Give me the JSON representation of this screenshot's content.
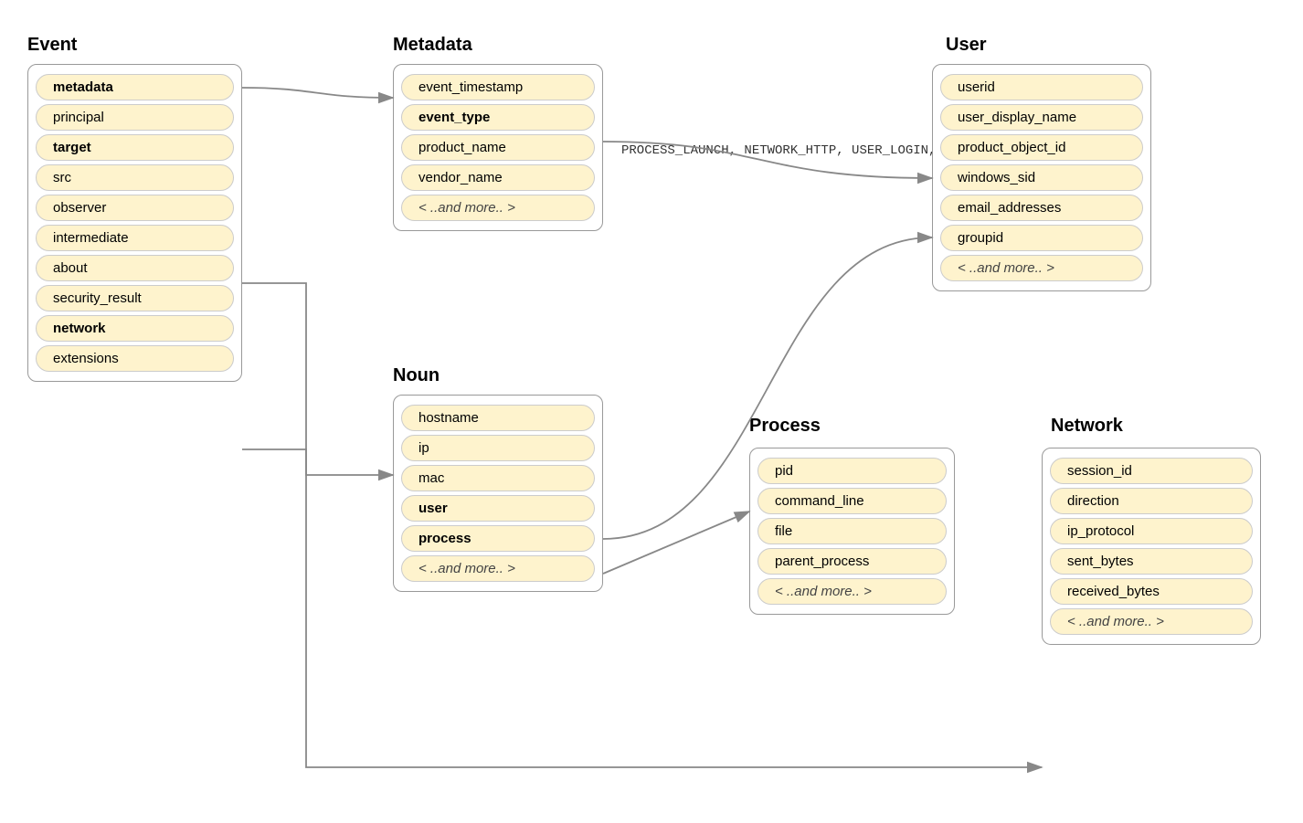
{
  "event": {
    "title": "Event",
    "items": [
      {
        "label": "metadata",
        "bold": true
      },
      {
        "label": "principal",
        "bold": false
      },
      {
        "label": "target",
        "bold": true
      },
      {
        "label": "src",
        "bold": false
      },
      {
        "label": "observer",
        "bold": false
      },
      {
        "label": "intermediate",
        "bold": false
      },
      {
        "label": "about",
        "bold": false
      },
      {
        "label": "security_result",
        "bold": false
      },
      {
        "label": "network",
        "bold": true
      },
      {
        "label": "extensions",
        "bold": false
      }
    ]
  },
  "metadata": {
    "title": "Metadata",
    "items": [
      {
        "label": "event_timestamp",
        "bold": false
      },
      {
        "label": "event_type",
        "bold": true
      },
      {
        "label": "product_name",
        "bold": false
      },
      {
        "label": "vendor_name",
        "bold": false
      },
      {
        "label": "< ..and more.. >",
        "italic": true
      }
    ]
  },
  "event_type_labels": "PROCESS_LAUNCH,\nNETWORK_HTTP,\nUSER_LOGIN,\netc.",
  "user": {
    "title": "User",
    "items": [
      {
        "label": "userid",
        "bold": false
      },
      {
        "label": "user_display_name",
        "bold": false
      },
      {
        "label": "product_object_id",
        "bold": false
      },
      {
        "label": "windows_sid",
        "bold": false
      },
      {
        "label": "email_addresses",
        "bold": false
      },
      {
        "label": "groupid",
        "bold": false
      },
      {
        "label": "< ..and more.. >",
        "italic": true
      }
    ]
  },
  "noun": {
    "title": "Noun",
    "items": [
      {
        "label": "hostname",
        "bold": false
      },
      {
        "label": "ip",
        "bold": false
      },
      {
        "label": "mac",
        "bold": false
      },
      {
        "label": "user",
        "bold": true
      },
      {
        "label": "process",
        "bold": true
      },
      {
        "label": "< ..and more.. >",
        "italic": true
      }
    ]
  },
  "process": {
    "title": "Process",
    "items": [
      {
        "label": "pid",
        "bold": false
      },
      {
        "label": "command_line",
        "bold": false
      },
      {
        "label": "file",
        "bold": false
      },
      {
        "label": "parent_process",
        "bold": false
      },
      {
        "label": "< ..and more.. >",
        "italic": true
      }
    ]
  },
  "network": {
    "title": "Network",
    "items": [
      {
        "label": "session_id",
        "bold": false
      },
      {
        "label": "direction",
        "bold": false
      },
      {
        "label": "ip_protocol",
        "bold": false
      },
      {
        "label": "sent_bytes",
        "bold": false
      },
      {
        "label": "received_bytes",
        "bold": false
      },
      {
        "label": "< ..and more.. >",
        "italic": true
      }
    ]
  }
}
